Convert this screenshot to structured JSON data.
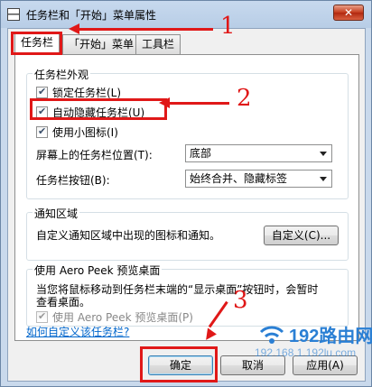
{
  "window": {
    "title": "任务栏和「开始」菜单属性",
    "close_glyph": "✕"
  },
  "tabs": [
    {
      "label": "任务栏",
      "active": true
    },
    {
      "label": "「开始」菜单",
      "active": false
    },
    {
      "label": "工具栏",
      "active": false
    }
  ],
  "appearance": {
    "title": "任务栏外观",
    "lock_label": "锁定任务栏(L)",
    "lock_checked": true,
    "autohide_label": "自动隐藏任务栏(U)",
    "autohide_checked": true,
    "small_icons_label": "使用小图标(I)",
    "small_icons_checked": true,
    "location_label": "屏幕上的任务栏位置(T):",
    "location_value": "底部",
    "buttons_label": "任务栏按钮(B):",
    "buttons_value": "始终合并、隐藏标签"
  },
  "notification": {
    "title": "通知区域",
    "description": "自定义通知区域中出现的图标和通知。",
    "customize_button": "自定义(C)..."
  },
  "aero": {
    "title": "使用 Aero Peek 预览桌面",
    "description_line1": "当您将鼠标移动到任务栏末端的“显示桌面”按钮时，会暂时",
    "description_line2": "查看桌面。",
    "checkbox_label": "使用 Aero Peek 预览桌面(P)",
    "checkbox_checked": true
  },
  "help_link": "如何自定义该任务栏?",
  "buttons": {
    "ok": "确定",
    "cancel": "取消",
    "apply": "应用(A)"
  },
  "annotations": {
    "step1": "1",
    "step2": "2",
    "step3": "3",
    "color": "#e01818"
  },
  "watermark": {
    "text": "192路由网",
    "subtext": "192.168.1.192lu.com"
  }
}
